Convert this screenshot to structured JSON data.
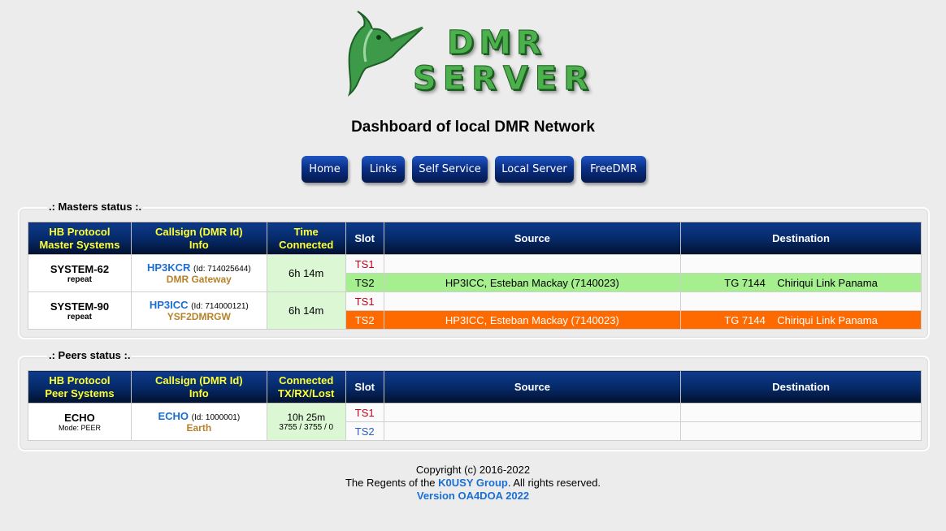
{
  "logo": {
    "line1": "DMR",
    "line2": "SERVER"
  },
  "title": "Dashboard of local DMR Network",
  "nav": {
    "items": [
      "Home",
      "Links",
      "Self Service",
      "Local Server",
      "FreeDMR"
    ]
  },
  "masters": {
    "legend": ".: Masters status :.",
    "headers": {
      "col1_line1": "HB Protocol",
      "col1_line2": "Master Systems",
      "col2_line1": "Callsign (DMR Id)",
      "col2_line2": "Info",
      "col3_line1": "Time",
      "col3_line2": "Connected",
      "slot": "Slot",
      "source": "Source",
      "destination": "Destination"
    },
    "rows": [
      {
        "system": "SYSTEM-62",
        "mode": "repeat",
        "callsign": "HP3KCR",
        "id": "(Id: 714025644)",
        "info": "DMR Gateway",
        "time": "6h 14m",
        "ts1": "TS1",
        "ts2": "TS2",
        "ts2_source": "HP3ICC, Esteban Mackay (7140023)",
        "ts2_dest": "TG 7144    Chiriqui Link Panama"
      },
      {
        "system": "SYSTEM-90",
        "mode": "repeat",
        "callsign": "HP3ICC",
        "id": "(Id: 714000121)",
        "info": "YSF2DMRGW",
        "time": "6h 14m",
        "ts1": "TS1",
        "ts2": "TS2",
        "ts2_source": "HP3ICC, Esteban Mackay (7140023)",
        "ts2_dest": "TG 7144    Chiriqui Link Panama"
      }
    ]
  },
  "peers": {
    "legend": ".: Peers status :.",
    "headers": {
      "col1_line1": "HB Protocol",
      "col1_line2": "Peer Systems",
      "col2_line1": "Callsign (DMR Id)",
      "col2_line2": "Info",
      "col3_line1": "Connected",
      "col3_line2": "TX/RX/Lost",
      "slot": "Slot",
      "source": "Source",
      "destination": "Destination"
    },
    "rows": [
      {
        "system": "ECHO",
        "mode": "Mode: PEER",
        "callsign": "ECHO",
        "id": "(Id: 1000001)",
        "info": "Earth",
        "time": "10h 25m",
        "stats": "3755 / 3755 / 0",
        "ts1": "TS1",
        "ts2": "TS2"
      }
    ]
  },
  "footer": {
    "copyright": "Copyright (c) 2016-2022",
    "regents_pre": "The Regents of the ",
    "group_link": "K0USY Group",
    "regents_post": ". All rights reserved.",
    "version": "Version OA4DOA 2022"
  },
  "colors": {
    "header_bg": "#062a6a",
    "header_yellow": "#ffff33",
    "active_green": "#a5ef8e",
    "active_orange": "#ff6a00",
    "time_bg": "#dbf7d3",
    "link_blue": "#1a6fd6",
    "info_brown": "#b5822a",
    "ts_red": "#c0001a"
  }
}
